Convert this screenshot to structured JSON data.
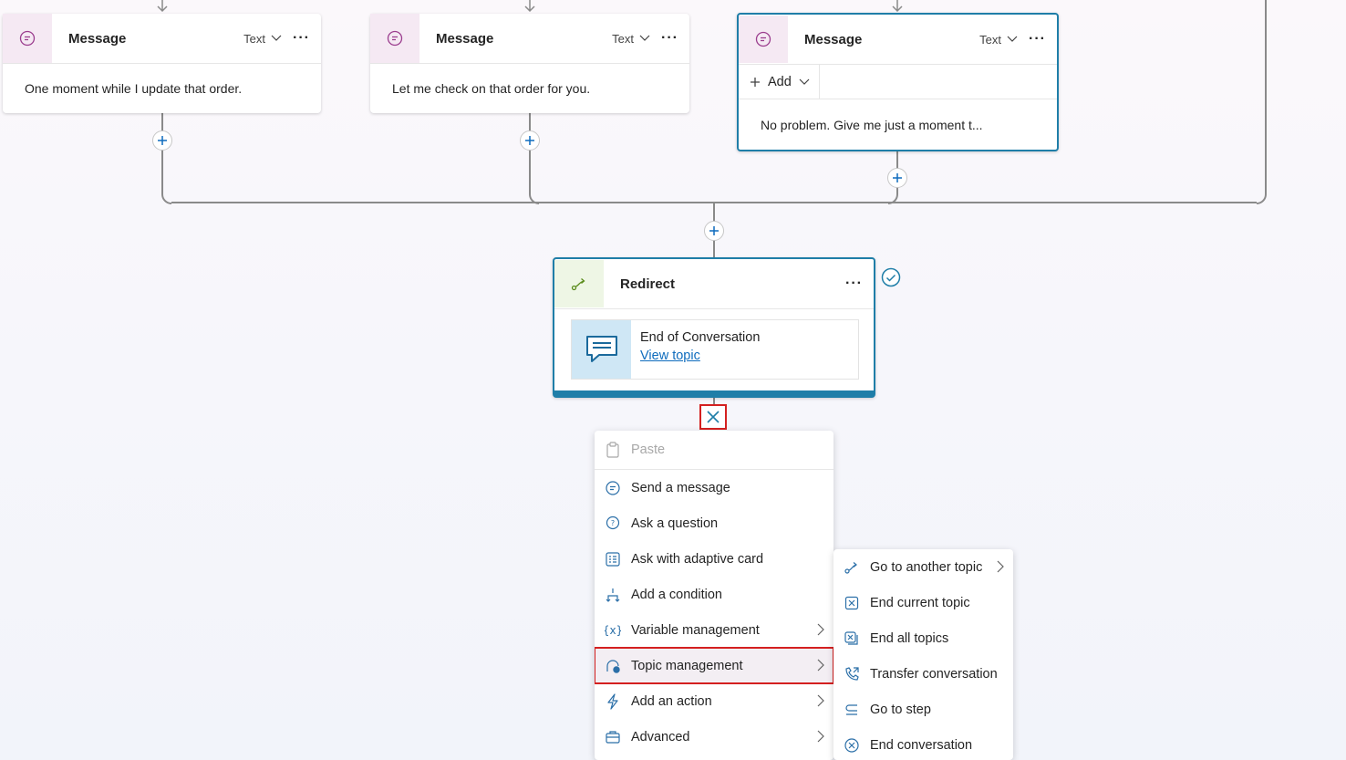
{
  "colors": {
    "accent": "#1f7ea8",
    "connector": "#8a8a8a",
    "highlight_border": "#d42020",
    "link": "#0f6cbd"
  },
  "message_cards": [
    {
      "title": "Message",
      "type_label": "Text",
      "body": "One moment while I update that order."
    },
    {
      "title": "Message",
      "type_label": "Text",
      "body": "Let me check on that order for you."
    },
    {
      "title": "Message",
      "type_label": "Text",
      "add_label": "Add",
      "body": "No problem. Give me just a moment t..."
    }
  ],
  "redirect": {
    "title": "Redirect",
    "topic_name": "End of Conversation",
    "view_topic_label": "View topic"
  },
  "menu": {
    "items": [
      {
        "label": "Paste",
        "icon": "clipboard-icon"
      },
      {
        "label": "Send a message",
        "icon": "chat-icon"
      },
      {
        "label": "Ask a question",
        "icon": "question-bubble-icon"
      },
      {
        "label": "Ask with adaptive card",
        "icon": "adaptive-card-icon"
      },
      {
        "label": "Add a condition",
        "icon": "branch-icon"
      },
      {
        "label": "Variable management",
        "icon": "variable-icon"
      },
      {
        "label": "Topic management",
        "icon": "topic-settings-icon"
      },
      {
        "label": "Add an action",
        "icon": "lightning-icon"
      },
      {
        "label": "Advanced",
        "icon": "briefcase-icon"
      }
    ]
  },
  "submenu": {
    "items": [
      {
        "label": "Go to another topic",
        "icon": "redirect-icon"
      },
      {
        "label": "End current topic",
        "icon": "end-topic-icon"
      },
      {
        "label": "End all topics",
        "icon": "end-all-icon"
      },
      {
        "label": "Transfer conversation",
        "icon": "transfer-call-icon"
      },
      {
        "label": "Go to step",
        "icon": "go-to-step-icon"
      },
      {
        "label": "End conversation",
        "icon": "end-conversation-icon"
      }
    ]
  }
}
